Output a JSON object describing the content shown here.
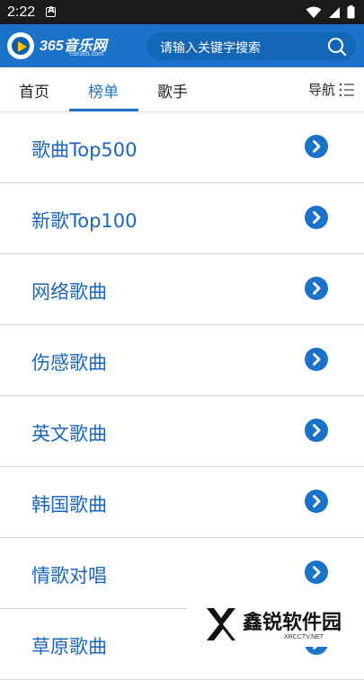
{
  "status_bar": {
    "time": "2:22"
  },
  "header": {
    "logo_text": "365音乐网",
    "logo_sub": "Yue365.com",
    "search_placeholder": "请输入关键字搜索"
  },
  "tabs": {
    "items": [
      "首页",
      "榜单",
      "歌手"
    ],
    "active_index": 1,
    "nav_label": "导航"
  },
  "list": {
    "items": [
      "歌曲Top500",
      "新歌Top100",
      "网络歌曲",
      "伤感歌曲",
      "英文歌曲",
      "韩国歌曲",
      "情歌对唱",
      "草原歌曲"
    ]
  },
  "watermark": {
    "text": "鑫锐软件园",
    "sub": "XRCCTV.NET"
  },
  "colors": {
    "brand": "#1a73c9",
    "link": "#1a66c0",
    "status_bar": "#1b1b1b"
  }
}
